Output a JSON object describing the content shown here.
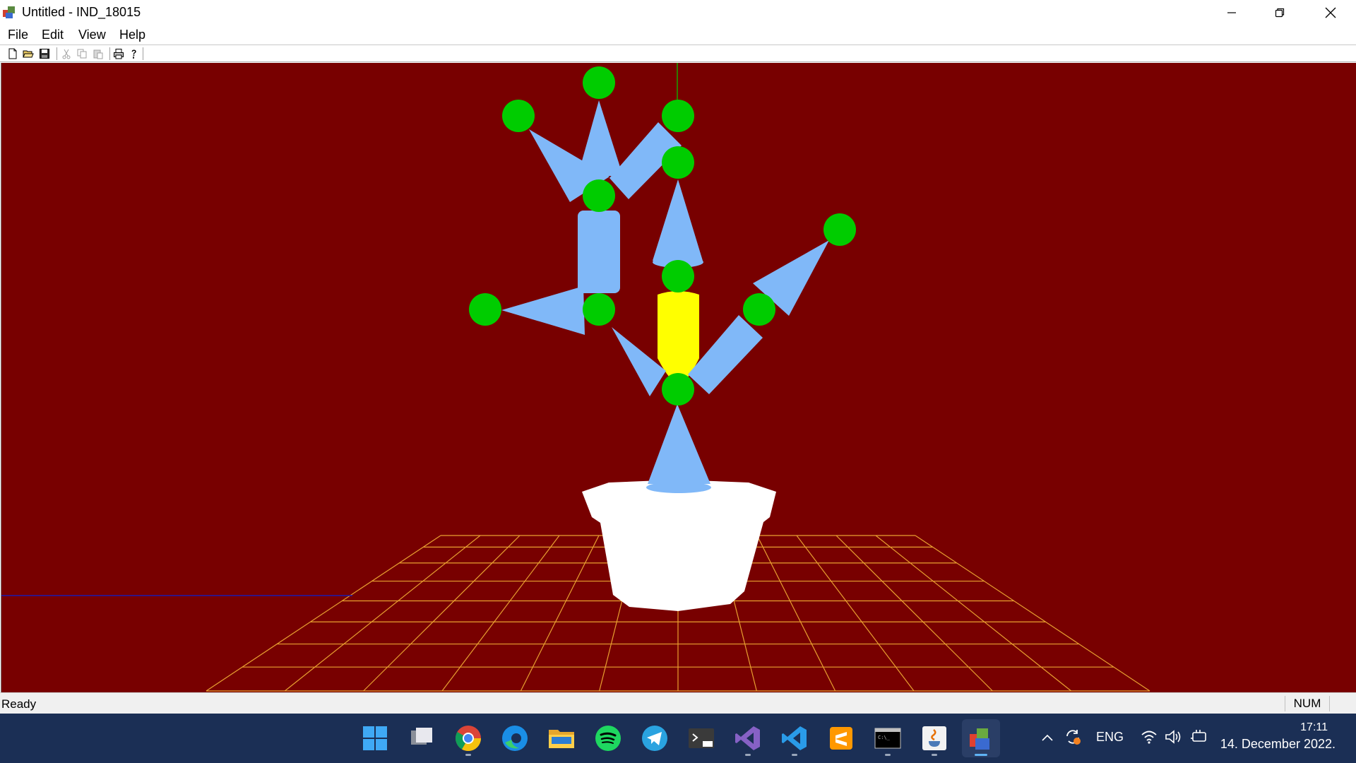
{
  "window": {
    "title": "Untitled - IND_18015",
    "icon": "mfc-app-icon",
    "controls": [
      "minimize-icon",
      "restore-icon",
      "close-icon"
    ]
  },
  "menu": [
    "File",
    "Edit",
    "View",
    "Help"
  ],
  "toolbar": {
    "buttons": [
      {
        "name": "new",
        "icon": "new-file-icon",
        "enabled": true
      },
      {
        "name": "open",
        "icon": "open-folder-icon",
        "enabled": true
      },
      {
        "name": "save",
        "icon": "save-disk-icon",
        "enabled": true
      },
      {
        "name": "cut",
        "icon": "cut-icon",
        "enabled": false
      },
      {
        "name": "copy",
        "icon": "copy-icon",
        "enabled": false
      },
      {
        "name": "paste",
        "icon": "paste-icon",
        "enabled": false
      },
      {
        "name": "print",
        "icon": "print-icon",
        "enabled": true
      },
      {
        "name": "about",
        "icon": "help-icon",
        "enabled": true
      }
    ]
  },
  "scene": {
    "background": "#780000",
    "grid_color": "#e8a030",
    "sphere_color": "#00cc00",
    "cone_color": "#80b8f8",
    "highlight_color": "#ffff00",
    "pot_color": "#ffffff",
    "axis_x_color": "#1a1ab0",
    "axis_y_color": "#00cc00"
  },
  "status": {
    "text": "Ready",
    "num": "NUM"
  },
  "taskbar": {
    "apps": [
      {
        "name": "start",
        "icon": "windows-start-icon",
        "running": false,
        "active": false
      },
      {
        "name": "task-view",
        "icon": "task-view-icon",
        "running": false,
        "active": false
      },
      {
        "name": "chrome",
        "icon": "chrome-icon",
        "running": true,
        "active": false
      },
      {
        "name": "edge",
        "icon": "edge-icon",
        "running": false,
        "active": false
      },
      {
        "name": "file-explorer",
        "icon": "folder-icon",
        "running": false,
        "active": false
      },
      {
        "name": "spotify",
        "icon": "spotify-icon",
        "running": false,
        "active": false
      },
      {
        "name": "telegram",
        "icon": "telegram-icon",
        "running": false,
        "active": false
      },
      {
        "name": "terminal-preview",
        "icon": "terminal-preview-icon",
        "running": false,
        "active": false
      },
      {
        "name": "visual-studio",
        "icon": "visual-studio-icon",
        "running": true,
        "active": false
      },
      {
        "name": "vscode",
        "icon": "vscode-icon",
        "running": true,
        "active": false
      },
      {
        "name": "sublime-text",
        "icon": "sublime-icon",
        "running": false,
        "active": false
      },
      {
        "name": "console",
        "icon": "console-icon",
        "running": true,
        "active": false
      },
      {
        "name": "java",
        "icon": "java-icon",
        "running": true,
        "active": false
      },
      {
        "name": "mfc-app",
        "icon": "mfc-app-icon",
        "running": true,
        "active": true
      }
    ],
    "tray": {
      "language": "ENG",
      "time": "17:11",
      "date": "14. December 2022."
    }
  }
}
